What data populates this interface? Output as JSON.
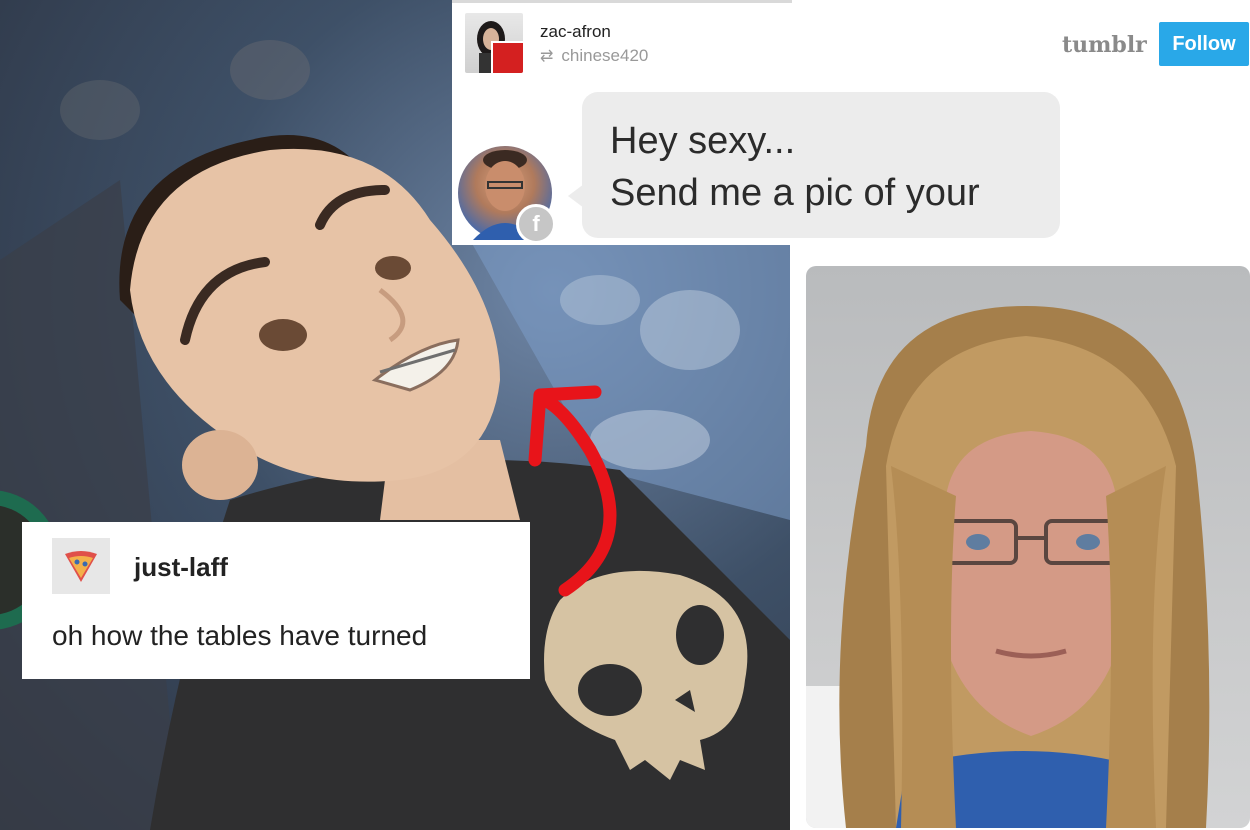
{
  "tumblr_post": {
    "username": "zac-afron",
    "reblogged_from": "chinese420",
    "platform_logo": "tumblr",
    "follow_label": "Follow",
    "message_line_1": "Hey sexy...",
    "message_line_2": "Send me a pic of your",
    "message_source_icon": "facebook-icon"
  },
  "caption_post": {
    "username": "just-laff",
    "avatar_icon": "pizza-icon",
    "text": "oh how the tables have turned"
  },
  "annotation": {
    "arrow_color": "#e8141a"
  },
  "colors": {
    "follow_button": "#29a8e8",
    "bubble": "#ececec"
  }
}
